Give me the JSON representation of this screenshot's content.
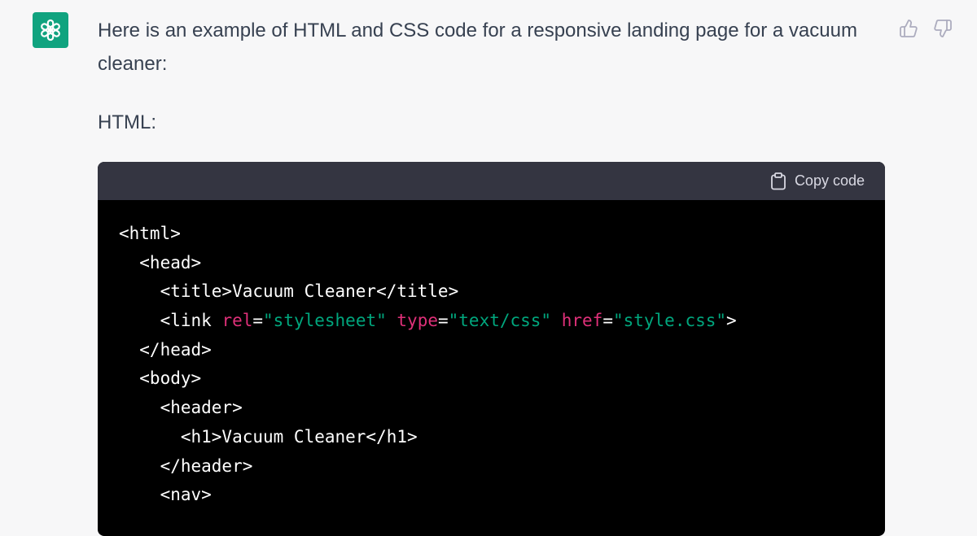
{
  "message": {
    "intro": "Here is an example of HTML and CSS code for a responsive landing page for a vacuum cleaner:",
    "section_label": "HTML:"
  },
  "feedback": {
    "thumbs_up_icon": "thumbs-up-icon",
    "thumbs_down_icon": "thumbs-down-icon"
  },
  "assistant_avatar": {
    "icon": "openai-logo-icon",
    "color": "#10a37f"
  },
  "code_block": {
    "copy_label": "Copy code",
    "copy_icon": "clipboard-icon",
    "colors": {
      "attribute": "#df3079",
      "string": "#00a67d",
      "text": "#ffffff",
      "header_bg": "#343541",
      "body_bg": "#000000"
    },
    "lines": [
      [
        {
          "t": "plain",
          "v": "<html>"
        }
      ],
      [
        {
          "t": "plain",
          "v": "  <head>"
        }
      ],
      [
        {
          "t": "plain",
          "v": "    <title>Vacuum Cleaner</title>"
        }
      ],
      [
        {
          "t": "plain",
          "v": "    <link "
        },
        {
          "t": "attr",
          "v": "rel"
        },
        {
          "t": "plain",
          "v": "="
        },
        {
          "t": "str",
          "v": "\"stylesheet\""
        },
        {
          "t": "plain",
          "v": " "
        },
        {
          "t": "attr",
          "v": "type"
        },
        {
          "t": "plain",
          "v": "="
        },
        {
          "t": "str",
          "v": "\"text/css\""
        },
        {
          "t": "plain",
          "v": " "
        },
        {
          "t": "attr",
          "v": "href"
        },
        {
          "t": "plain",
          "v": "="
        },
        {
          "t": "str",
          "v": "\"style.css\""
        },
        {
          "t": "plain",
          "v": ">"
        }
      ],
      [
        {
          "t": "plain",
          "v": "  </head>"
        }
      ],
      [
        {
          "t": "plain",
          "v": "  <body>"
        }
      ],
      [
        {
          "t": "plain",
          "v": "    <header>"
        }
      ],
      [
        {
          "t": "plain",
          "v": "      <h1>Vacuum Cleaner</h1>"
        }
      ],
      [
        {
          "t": "plain",
          "v": "    </header>"
        }
      ],
      [
        {
          "t": "plain",
          "v": "    <nav>"
        }
      ]
    ]
  }
}
